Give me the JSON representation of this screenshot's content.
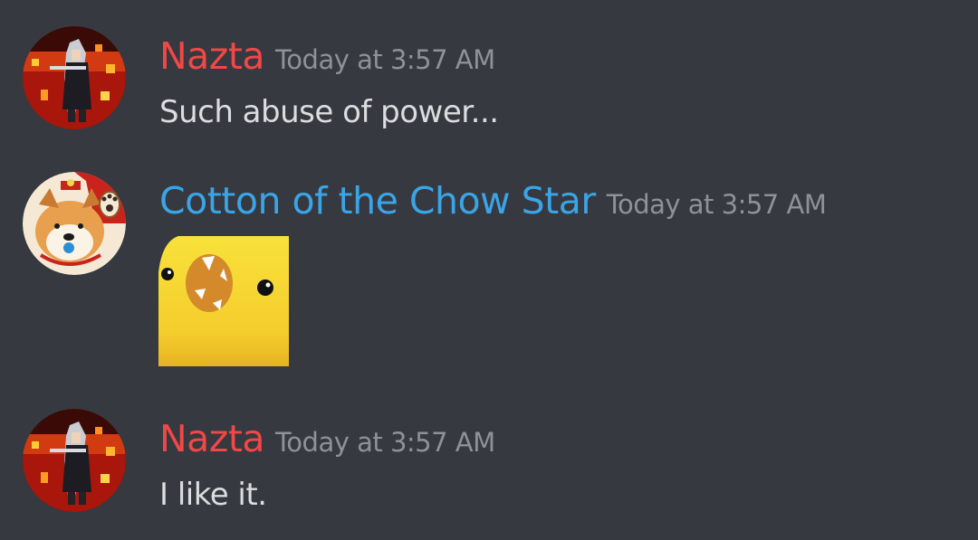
{
  "messages": [
    {
      "author": "Nazta",
      "author_color": "#f04747",
      "timestamp": "Today at 3:57 AM",
      "text": "Such abuse of power..."
    },
    {
      "author": "Cotton of the Chow Star",
      "author_color": "#3ba4e6",
      "timestamp": "Today at 3:57 AM",
      "attachment": "yellow-chick-emoji"
    },
    {
      "author": "Nazta",
      "author_color": "#f04747",
      "timestamp": "Today at 3:57 AM",
      "text": "I like it."
    }
  ]
}
